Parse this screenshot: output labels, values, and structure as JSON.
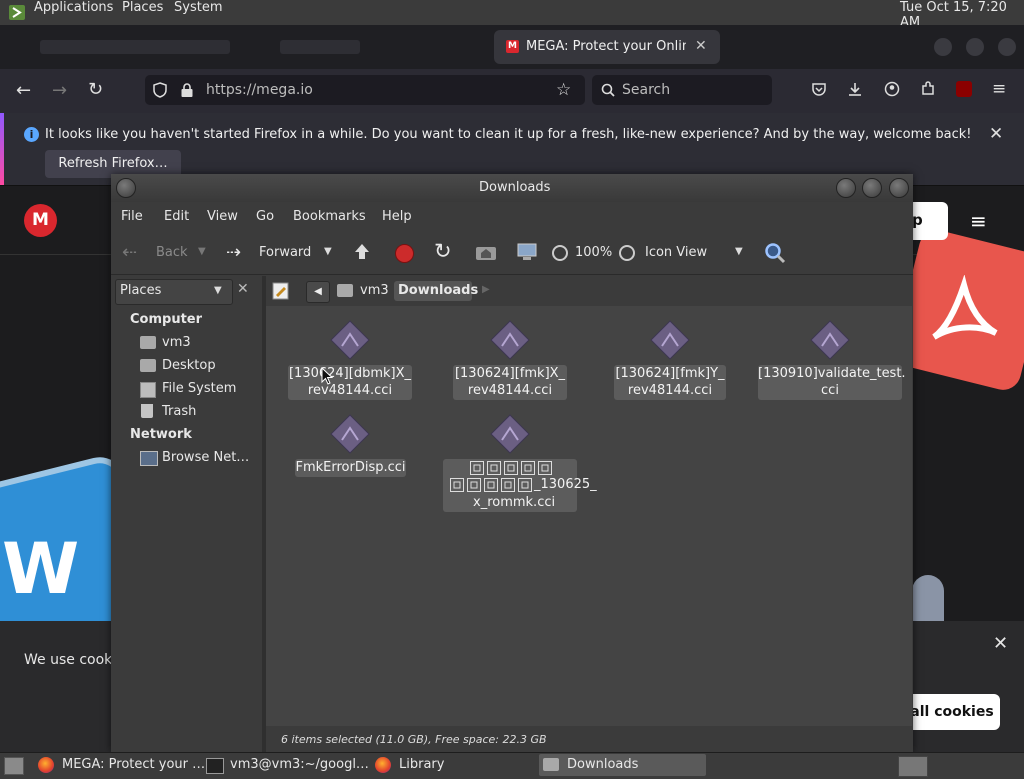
{
  "top_panel": {
    "menus": [
      "Applications",
      "Places",
      "System"
    ],
    "clock": "Tue Oct 15,  7:20 AM"
  },
  "browser": {
    "active_tab_title": "MEGA: Protect your Online",
    "url": "https://mega.io",
    "search_placeholder": "Search",
    "notification": "It looks like you haven't started Firefox in a while. Do you want to clean it up for a fresh, like-new experience? And by the way, welcome back!",
    "refresh_button": "Refresh Firefox…"
  },
  "mega_page": {
    "logo_letter": "M",
    "white_button_fragment": "p",
    "cookie_text": "We use cooki",
    "cookie_button": "all cookies"
  },
  "file_manager": {
    "title": "Downloads",
    "menu": [
      "File",
      "Edit",
      "View",
      "Go",
      "Bookmarks",
      "Help"
    ],
    "toolbar": {
      "back": "Back",
      "forward": "Forward",
      "zoom": "100%",
      "view_mode": "Icon View"
    },
    "sidebar": {
      "combo": "Places",
      "sections": [
        {
          "title": "Computer",
          "items": [
            "vm3",
            "Desktop",
            "File System",
            "Trash"
          ]
        },
        {
          "title": "Network",
          "items": [
            "Browse Net…"
          ]
        }
      ]
    },
    "path": [
      "vm3",
      "Downloads"
    ],
    "files": [
      {
        "line1": "[130624][dbmk]X_",
        "line2": "rev48144.cci"
      },
      {
        "line1": "[130624][fmk]X_",
        "line2": "rev48144.cci"
      },
      {
        "line1": "[130624][fmk]Y_",
        "line2": "rev48144.cci"
      },
      {
        "line1": "[130910]validate_test.",
        "line2": "cci"
      },
      {
        "line1": "FmkErrorDisp.cci",
        "line2": ""
      },
      {
        "line1": "_130625_",
        "line2": "x_rommk.cci"
      }
    ],
    "status": "6 items selected (11.0 GB), Free space: 22.3 GB"
  },
  "taskbar": {
    "items": [
      "MEGA: Protect your …",
      "vm3@vm3:~/googl…",
      "Library",
      "Downloads"
    ]
  }
}
